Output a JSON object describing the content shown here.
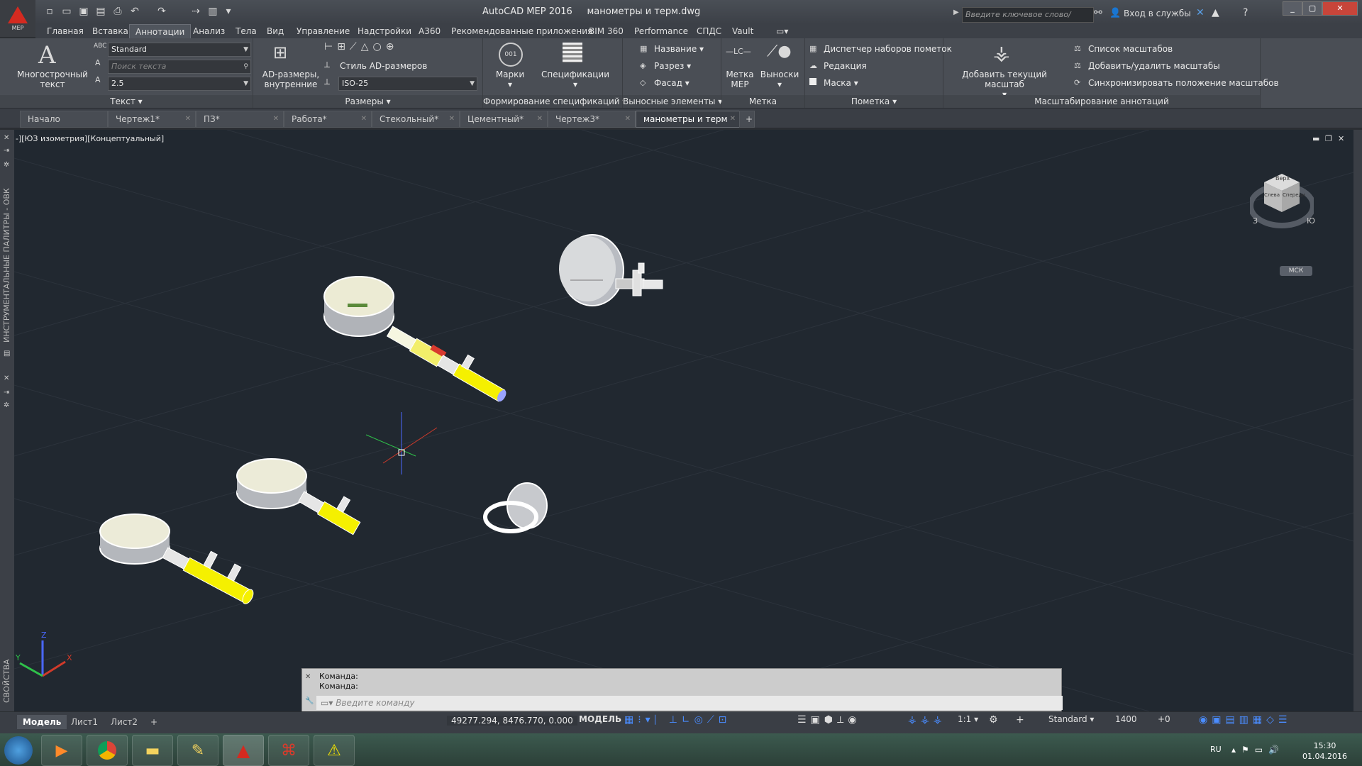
{
  "app": {
    "logo_label": "MEP",
    "title": "AutoCAD MEP 2016",
    "filename": "манометры и терм.dwg",
    "search_placeholder": "Введите ключевое слово/фразу",
    "signin": "Вход в службы"
  },
  "ribbon_tabs": [
    "Главная",
    "Вставка",
    "Аннотации",
    "Анализ",
    "Тела",
    "Вид",
    "Управление",
    "Надстройки",
    "A360",
    "Рекомендованные приложения",
    "BIM 360",
    "Performance",
    "СПДС",
    "Vault"
  ],
  "ribbon": {
    "text_panel": {
      "title": "Текст",
      "multiline_label_1": "Многострочный",
      "multiline_label_2": "текст",
      "style_value": "Standard",
      "find_placeholder": "Поиск текста",
      "height_value": "2.5"
    },
    "dims_panel": {
      "title": "Размеры",
      "ad_label_1": "AD-размеры,",
      "ad_label_2": "внутренние",
      "style_label": "Стиль AD-размеров",
      "style_value": "ISO-25"
    },
    "schedules_panel": {
      "title": "Формирование спецификаций",
      "tags_label": "Марки",
      "schedules_label": "Спецификации"
    },
    "callouts_panel": {
      "title": "Выносные элементы",
      "name_label": "Название",
      "section_label": "Разрез",
      "elevation_label": "Фасад"
    },
    "label_panel": {
      "title": "Метка",
      "mep_label_1": "Метка",
      "mep_label_2": "MEP",
      "leaders_label": "Выноски"
    },
    "markup_panel": {
      "title": "Пометка",
      "manager_label": "Диспетчер наборов пометок",
      "edit_label": "Редакция",
      "mask_label": "Маска"
    },
    "scale_panel": {
      "title": "Масштабирование аннотаций",
      "add_current_label": "Добавить текущий масштаб",
      "scale_list_label": "Список масштабов",
      "add_remove_label": "Добавить/удалить масштабы",
      "sync_label": "Синхронизировать положение масштабов"
    }
  },
  "file_tabs": [
    {
      "label": "Начало",
      "active": false
    },
    {
      "label": "Чертеж1*",
      "active": false
    },
    {
      "label": "ПЗ*",
      "active": false
    },
    {
      "label": "Работа*",
      "active": false
    },
    {
      "label": "Стекольный*",
      "active": false
    },
    {
      "label": "Цементный*",
      "active": false
    },
    {
      "label": "Чертеж3*",
      "active": false
    },
    {
      "label": "манометры и терм",
      "active": true
    }
  ],
  "viewport": {
    "label": "-][ЮЗ изометрия][Концептуальный]",
    "viewcube_top": "Верх",
    "viewcube_left": "Слева",
    "viewcube_front": "Спереди",
    "compass_s": "Ю",
    "compass_w": "З",
    "ucs_button": "МСК",
    "left_palette_1": "ИНСТРУМЕНТАЛЬНЫЕ ПАЛИТРЫ - ОВК",
    "left_palette_2": "СВОЙСТВА"
  },
  "command": {
    "history_1": "Команда:",
    "history_2": "Команда:",
    "placeholder": "Введите команду"
  },
  "layout_tabs": [
    "Модель",
    "Лист1",
    "Лист2"
  ],
  "status": {
    "coords": "49277.294, 8476.770, 0.000",
    "mode": "МОДЕЛЬ",
    "scale": "1:1",
    "style": "Standard",
    "elevation": "1400",
    "offset": "+0"
  },
  "taskbar": {
    "lang": "RU",
    "time": "15:30",
    "date": "01.04.2016"
  },
  "colors": {
    "viewport_bg": "#212830",
    "gauge_body": "#e6e6e6",
    "valve_yellow": "#f5f000",
    "autocad_red": "#d42a20"
  }
}
